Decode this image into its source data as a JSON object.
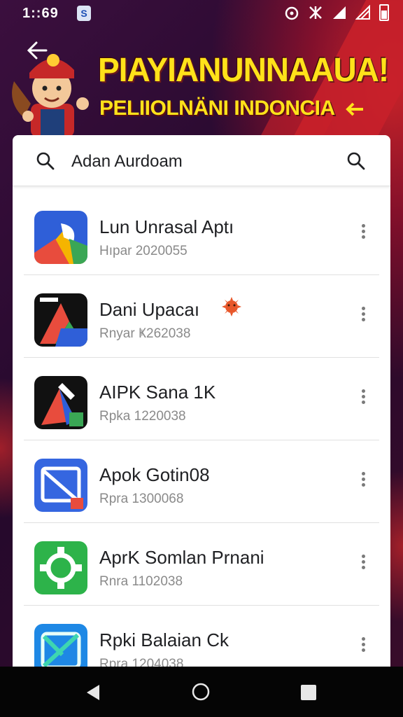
{
  "status_bar": {
    "time": "1::69",
    "notification_glyph": "S"
  },
  "banner": {
    "title": "PIAYIANUNNAAUA!",
    "subtitle": "PELIIOLNÄNI INDONCIA"
  },
  "search": {
    "value": "Adan Aurdoam"
  },
  "apps": [
    {
      "name": "Lun Unrasal Aptı",
      "sub": "Hıpar 2020055",
      "icon": "blue-shape-icon"
    },
    {
      "name": "Dani Upacaı",
      "sub": "Rnyar Ҝ262038",
      "icon": "dark-triangle-icon"
    },
    {
      "name": "AIPK Sana 1K",
      "sub": "Rpka 1220038",
      "icon": "black-shape-icon"
    },
    {
      "name": "Apok Gotin08",
      "sub": "Rpra 1300068",
      "icon": "blue-frame-icon"
    },
    {
      "name": "AprK Somlan Prnani",
      "sub": "Rnra 1102038",
      "icon": "green-gear-icon"
    },
    {
      "name": "Rpki Balaian Ck",
      "sub": "Rpra 1204038",
      "icon": "teal-x-icon"
    }
  ],
  "colors": {
    "accent_yellow": "#ffe21a",
    "banner_red": "#c8202a",
    "nav_bg": "#050505"
  }
}
